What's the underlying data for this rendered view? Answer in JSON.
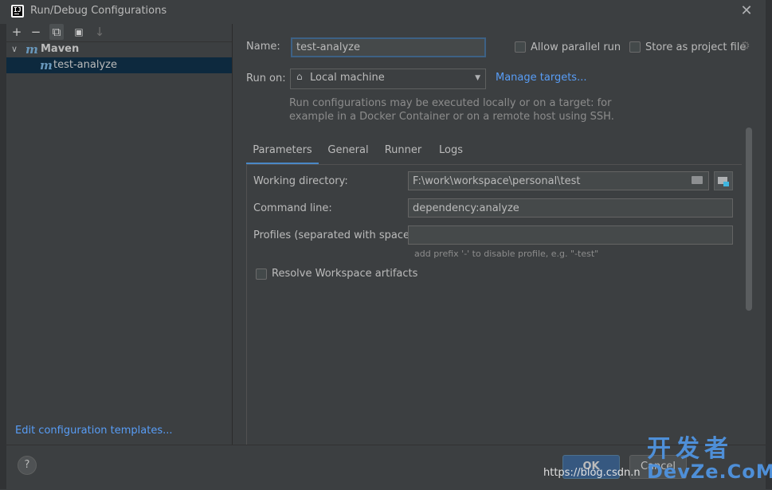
{
  "window": {
    "title": "Run/Debug Configurations",
    "close_glyph": "✕"
  },
  "toolbar": {
    "add": "+",
    "remove": "−",
    "copy": "⧉",
    "folder": "▣",
    "sort": "↓"
  },
  "tree": {
    "group_label": "Maven",
    "group_icon": "m",
    "item_label": "test-analyze",
    "item_icon": "m"
  },
  "left_footer": {
    "templates_link": "Edit configuration templates..."
  },
  "form": {
    "name_label": "Name:",
    "name_value": "test-analyze",
    "allow_parallel_label": "Allow parallel run",
    "store_label": "Store as project file",
    "run_on_label": "Run on:",
    "run_on_value": "Local machine",
    "manage_targets": "Manage targets...",
    "hint_line1": "Run configurations may be executed locally or on a target: for",
    "hint_line2": "example in a Docker Container or on a remote host using SSH."
  },
  "tabs": [
    "Parameters",
    "General",
    "Runner",
    "Logs"
  ],
  "parameters": {
    "working_dir_label": "Working directory:",
    "working_dir_value": "F:\\work\\workspace\\personal\\test",
    "command_line_label": "Command line:",
    "command_line_value": "dependency:analyze",
    "profiles_label": "Profiles (separated with space):",
    "profiles_value": "",
    "profiles_hint": "add prefix '-' to disable profile, e.g. \"-test\"",
    "resolve_label": "Resolve Workspace artifacts"
  },
  "footer": {
    "help": "?",
    "ok": "OK",
    "cancel": "Cancel"
  },
  "watermark": {
    "url": "https://blog.csdn.n",
    "logo_line1": "开发者",
    "logo_line2": "DevZe.CoM"
  },
  "colors": {
    "background": "#3c3f41",
    "link": "#589df6",
    "selection": "#0d293e",
    "accent_tab": "#4a88c7",
    "ok_button": "#365880"
  }
}
